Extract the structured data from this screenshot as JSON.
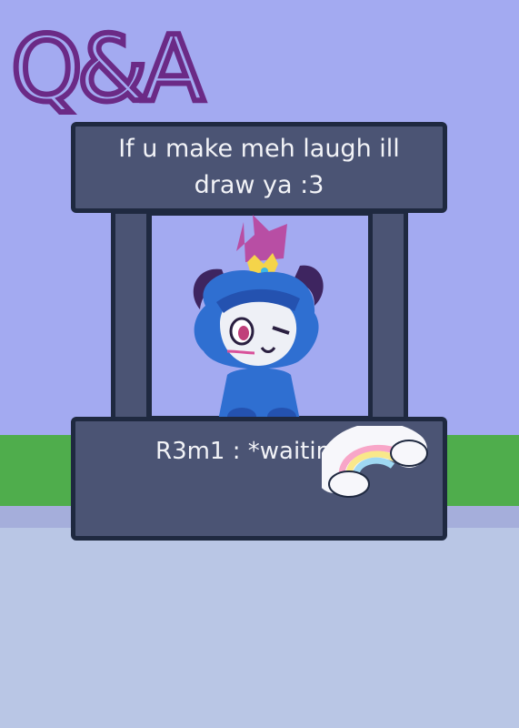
{
  "title": "Q&A",
  "prompt": "If u make meh laugh ill draw ya :3",
  "status": "R3m1 : *waiting*",
  "colors": {
    "sky": "#a3aaf1",
    "grass": "#4fad4c",
    "booth": "#4b5474",
    "outline": "#1f2940",
    "title_purple": "#6b2a86"
  }
}
